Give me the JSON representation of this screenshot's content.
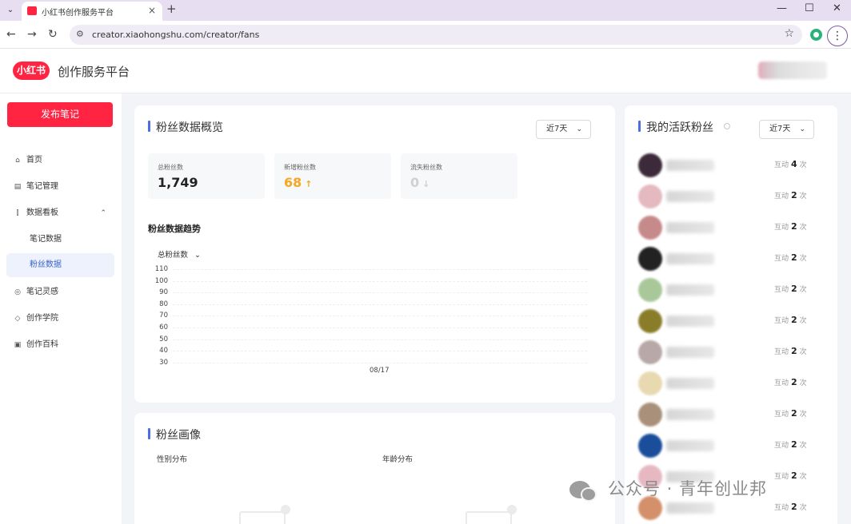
{
  "browser": {
    "tab_title": "小红书创作服务平台",
    "tab_close": "×",
    "new_tab": "+",
    "url": "creator.xiaohongshu.com/creator/fans",
    "minimize": "—",
    "maximize": "☐",
    "close": "✕",
    "back": "←",
    "forward": "→",
    "reload": "↻",
    "star": "☆",
    "menu": "⋮",
    "tab_menu": "⌄"
  },
  "header": {
    "logo": "小红书",
    "brand": "创作服务平台"
  },
  "sidebar": {
    "publish": "发布笔记",
    "items": [
      {
        "label": "首页",
        "icon": "⌂"
      },
      {
        "label": "笔记管理",
        "icon": "▤"
      },
      {
        "label": "数据看板",
        "icon": "⫿"
      },
      {
        "label": "笔记数据",
        "icon": ""
      },
      {
        "label": "粉丝数据",
        "icon": ""
      },
      {
        "label": "笔记灵感",
        "icon": "◎"
      },
      {
        "label": "创作学院",
        "icon": "◇"
      },
      {
        "label": "创作百科",
        "icon": "▣"
      }
    ],
    "caret": "⌃"
  },
  "overview": {
    "title": "粉丝数据概览",
    "range": "近7天",
    "stats": [
      {
        "label": "总粉丝数",
        "value": "1,749",
        "arrow": "",
        "color": "#222222"
      },
      {
        "label": "新增粉丝数",
        "value": "68",
        "arrow": "↑",
        "color": "#f5a623"
      },
      {
        "label": "流失粉丝数",
        "value": "0",
        "arrow": "↓",
        "color": "#d0d0d0"
      }
    ],
    "trend_title": "粉丝数据趋势",
    "metric": "总粉丝数"
  },
  "chart_data": {
    "type": "line",
    "x": [
      "08/17"
    ],
    "y_ticks": [
      110,
      100,
      90,
      80,
      70,
      60,
      50,
      40,
      30
    ],
    "ylim": [
      30,
      110
    ],
    "grid": true,
    "series": []
  },
  "portrait": {
    "title": "粉丝画像",
    "gender": "性别分布",
    "age": "年龄分布"
  },
  "active_fans": {
    "title": "我的活跃粉丝",
    "range": "近7天",
    "prefix": "互动",
    "suffix": "次",
    "items": [
      {
        "count": "4",
        "avatar": "#3c2a3a"
      },
      {
        "count": "2",
        "avatar": "#e4b9c0"
      },
      {
        "count": "2",
        "avatar": "#c78a8a"
      },
      {
        "count": "2",
        "avatar": "#222222"
      },
      {
        "count": "2",
        "avatar": "#a8c89a"
      },
      {
        "count": "2",
        "avatar": "#8a7d2a"
      },
      {
        "count": "2",
        "avatar": "#b8a8a8"
      },
      {
        "count": "2",
        "avatar": "#e8d9b0"
      },
      {
        "count": "2",
        "avatar": "#a8907a"
      },
      {
        "count": "2",
        "avatar": "#1a4e9a"
      },
      {
        "count": "2",
        "avatar": "#e6b9c2"
      },
      {
        "count": "2",
        "avatar": "#d4906a"
      }
    ]
  },
  "watermark": "公众号 · 青年创业邦"
}
